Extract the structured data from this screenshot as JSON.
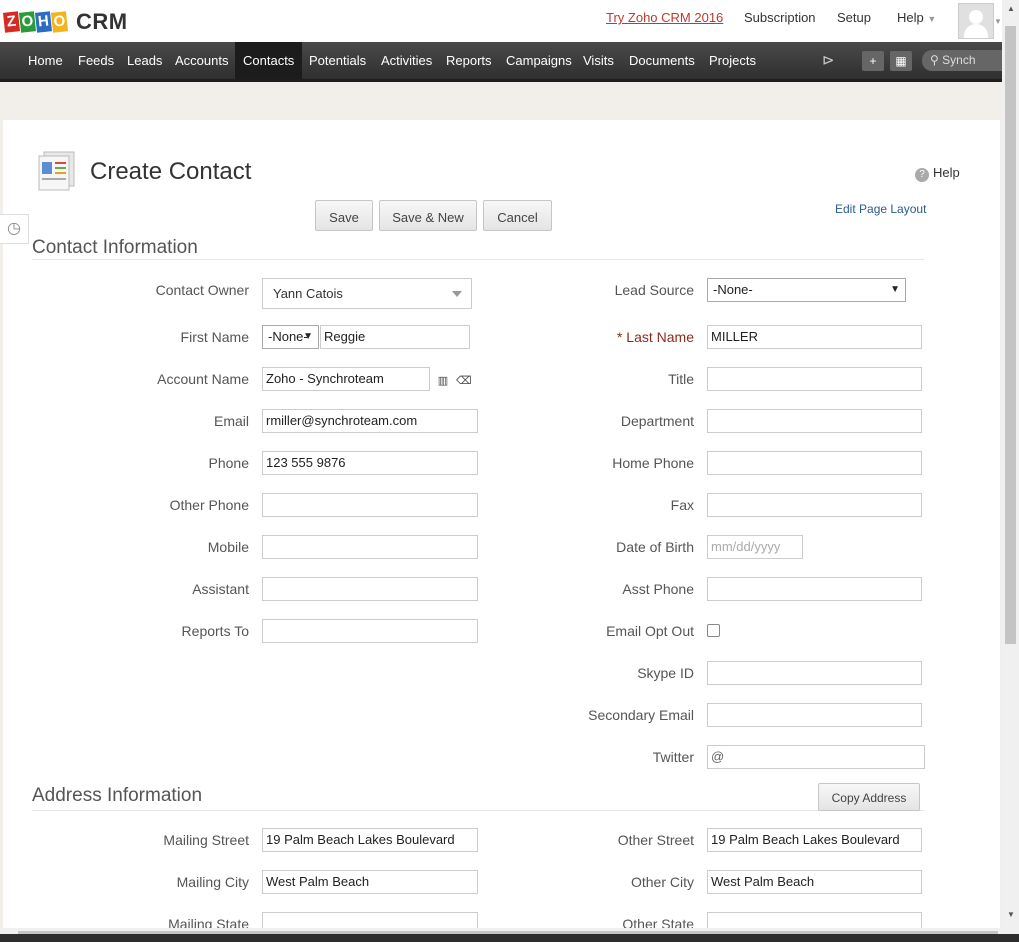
{
  "app": {
    "logo_letters": [
      "Z",
      "O",
      "H",
      "O"
    ],
    "logo_colors": [
      "#d82a24",
      "#2a9b3a",
      "#2b6cc4",
      "#f2b31b"
    ],
    "product": "CRM"
  },
  "top_links": {
    "try": "Try Zoho CRM 2016",
    "subscription": "Subscription",
    "setup": "Setup",
    "help": "Help"
  },
  "nav": [
    "Home",
    "Feeds",
    "Leads",
    "Accounts",
    "Contacts",
    "Potentials",
    "Activities",
    "Reports",
    "Campaigns",
    "Visits",
    "Documents",
    "Projects"
  ],
  "nav_active": "Contacts",
  "search": {
    "placeholder": "Synch"
  },
  "page": {
    "title": "Create Contact",
    "help": "Help",
    "edit_layout": "Edit Page Layout"
  },
  "buttons": {
    "save": "Save",
    "save_new": "Save & New",
    "cancel": "Cancel",
    "copy_address": "Copy Address"
  },
  "sections": {
    "contact": "Contact Information",
    "address": "Address Information"
  },
  "fields": {
    "contact_owner": {
      "label": "Contact Owner",
      "value": "Yann Catois"
    },
    "lead_source": {
      "label": "Lead Source",
      "value": "-None-"
    },
    "first_name": {
      "label": "First Name",
      "salutation": "-None-",
      "value": "Reggie"
    },
    "last_name": {
      "label": "* Last Name",
      "value": "MILLER"
    },
    "account_name": {
      "label": "Account Name",
      "value": "Zoho - Synchroteam"
    },
    "title": {
      "label": "Title",
      "value": ""
    },
    "email": {
      "label": "Email",
      "value": "rmiller@synchroteam.com"
    },
    "department": {
      "label": "Department",
      "value": ""
    },
    "phone": {
      "label": "Phone",
      "value": "123 555 9876"
    },
    "home_phone": {
      "label": "Home Phone",
      "value": ""
    },
    "other_phone": {
      "label": "Other Phone",
      "value": ""
    },
    "fax": {
      "label": "Fax",
      "value": ""
    },
    "mobile": {
      "label": "Mobile",
      "value": ""
    },
    "date_of_birth": {
      "label": "Date of Birth",
      "placeholder": "mm/dd/yyyy"
    },
    "assistant": {
      "label": "Assistant",
      "value": ""
    },
    "asst_phone": {
      "label": "Asst Phone",
      "value": ""
    },
    "reports_to": {
      "label": "Reports To",
      "value": ""
    },
    "email_opt_out": {
      "label": "Email Opt Out",
      "checked": false
    },
    "skype_id": {
      "label": "Skype ID",
      "value": ""
    },
    "secondary_email": {
      "label": "Secondary Email",
      "value": ""
    },
    "twitter": {
      "label": "Twitter",
      "value": "@"
    },
    "mailing_street": {
      "label": "Mailing Street",
      "value": "19 Palm Beach Lakes Boulevard"
    },
    "other_street": {
      "label": "Other Street",
      "value": "19 Palm Beach Lakes Boulevard"
    },
    "mailing_city": {
      "label": "Mailing City",
      "value": "West Palm Beach"
    },
    "other_city": {
      "label": "Other City",
      "value": "West Palm Beach"
    },
    "mailing_state": {
      "label": "Mailing State",
      "value": ""
    },
    "other_state": {
      "label": "Other State",
      "value": ""
    }
  }
}
